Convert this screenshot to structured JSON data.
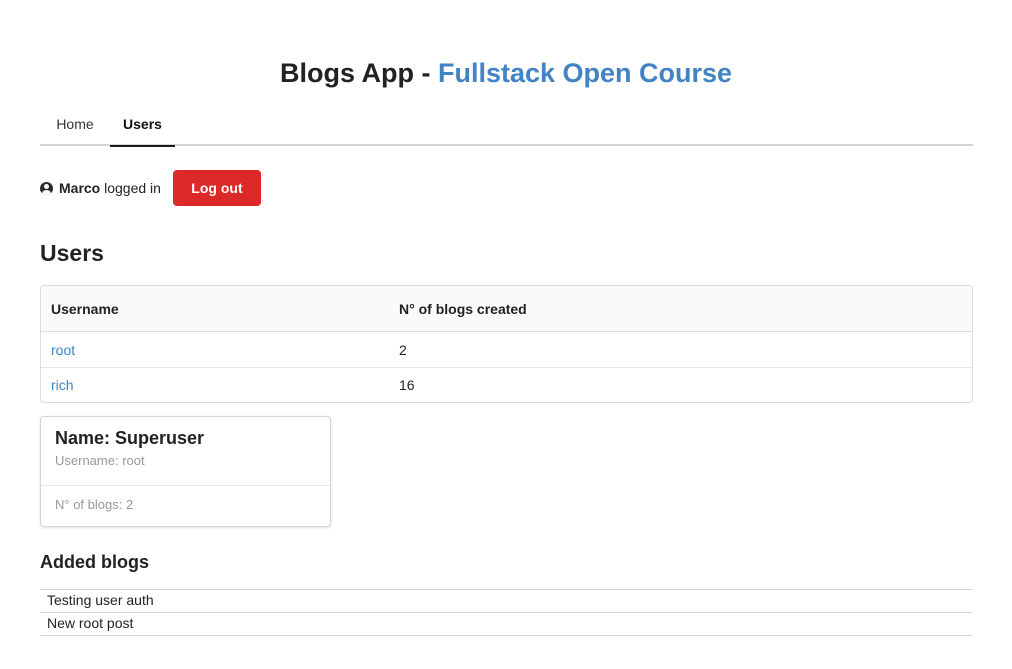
{
  "header": {
    "title_prefix": "Blogs App - ",
    "title_accent": "Fullstack Open Course",
    "accent_color": "#4183c4"
  },
  "menu": {
    "items": [
      {
        "label": "Home"
      },
      {
        "label": "Users",
        "active": true
      }
    ]
  },
  "session": {
    "user_name": "Marco",
    "status_text": " logged in",
    "icon": "user-circle-icon",
    "logout_label": "Log out",
    "logout_color": "#db2828"
  },
  "users_section": {
    "heading": "Users",
    "columns": [
      "Username",
      "N° of blogs created"
    ],
    "rows": [
      {
        "username": "root",
        "blogs": "2"
      },
      {
        "username": "rich",
        "blogs": "16"
      }
    ]
  },
  "user_card": {
    "name": "Name: Superuser",
    "username": "Username: root",
    "blogs": "N° of blogs: 2"
  },
  "added_blogs": {
    "heading": "Added blogs",
    "items": [
      "Testing user auth",
      "New root post"
    ]
  }
}
